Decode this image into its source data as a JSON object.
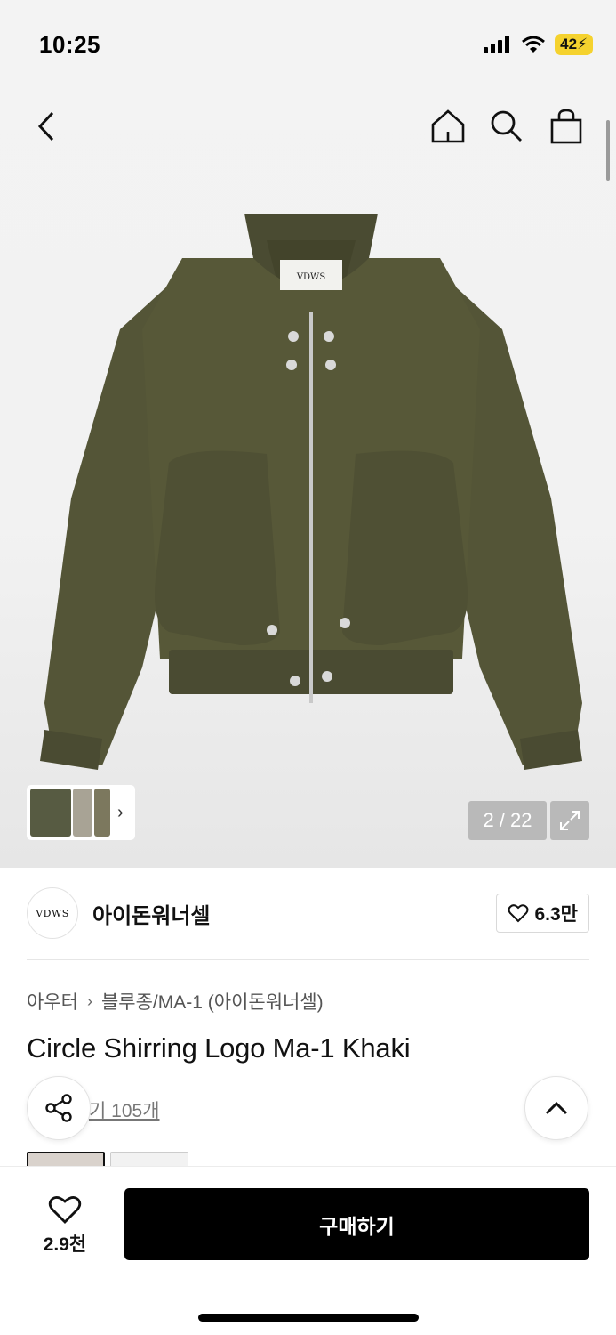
{
  "status_bar": {
    "time": "10:25",
    "battery": "42",
    "icons": [
      "signal-icon",
      "wifi-icon",
      "battery-icon"
    ]
  },
  "nav": {
    "icons": [
      "back-icon",
      "home-icon",
      "search-icon",
      "cart-icon"
    ]
  },
  "gallery": {
    "pager": "2 / 22",
    "jacket_label": "VDWS",
    "colors": {
      "jacket": "#545537",
      "jacket_shadow": "#43442b",
      "rib": "#4a4b32"
    }
  },
  "brand": {
    "logo_text": "VDWS",
    "name": "아이돈워너셀",
    "likes": "6.3만"
  },
  "breadcrumb": {
    "category": "아우터",
    "subcategory": "블루종/MA-1 (아이돈워너셀)"
  },
  "product": {
    "title": "Circle Shirring Logo Ma-1 Khaki",
    "review_text": "기 105개"
  },
  "bottom": {
    "wish_count": "2.9천",
    "buy_label": "구매하기"
  }
}
